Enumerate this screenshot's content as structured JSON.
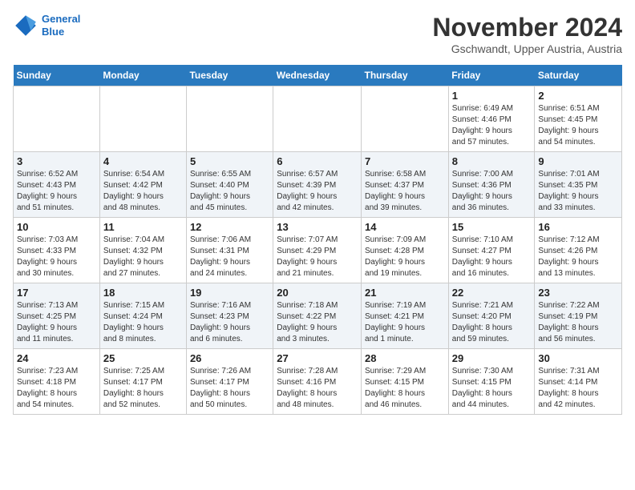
{
  "header": {
    "logo_line1": "General",
    "logo_line2": "Blue",
    "month": "November 2024",
    "location": "Gschwandt, Upper Austria, Austria"
  },
  "weekdays": [
    "Sunday",
    "Monday",
    "Tuesday",
    "Wednesday",
    "Thursday",
    "Friday",
    "Saturday"
  ],
  "weeks": [
    [
      {
        "day": "",
        "info": ""
      },
      {
        "day": "",
        "info": ""
      },
      {
        "day": "",
        "info": ""
      },
      {
        "day": "",
        "info": ""
      },
      {
        "day": "",
        "info": ""
      },
      {
        "day": "1",
        "info": "Sunrise: 6:49 AM\nSunset: 4:46 PM\nDaylight: 9 hours\nand 57 minutes."
      },
      {
        "day": "2",
        "info": "Sunrise: 6:51 AM\nSunset: 4:45 PM\nDaylight: 9 hours\nand 54 minutes."
      }
    ],
    [
      {
        "day": "3",
        "info": "Sunrise: 6:52 AM\nSunset: 4:43 PM\nDaylight: 9 hours\nand 51 minutes."
      },
      {
        "day": "4",
        "info": "Sunrise: 6:54 AM\nSunset: 4:42 PM\nDaylight: 9 hours\nand 48 minutes."
      },
      {
        "day": "5",
        "info": "Sunrise: 6:55 AM\nSunset: 4:40 PM\nDaylight: 9 hours\nand 45 minutes."
      },
      {
        "day": "6",
        "info": "Sunrise: 6:57 AM\nSunset: 4:39 PM\nDaylight: 9 hours\nand 42 minutes."
      },
      {
        "day": "7",
        "info": "Sunrise: 6:58 AM\nSunset: 4:37 PM\nDaylight: 9 hours\nand 39 minutes."
      },
      {
        "day": "8",
        "info": "Sunrise: 7:00 AM\nSunset: 4:36 PM\nDaylight: 9 hours\nand 36 minutes."
      },
      {
        "day": "9",
        "info": "Sunrise: 7:01 AM\nSunset: 4:35 PM\nDaylight: 9 hours\nand 33 minutes."
      }
    ],
    [
      {
        "day": "10",
        "info": "Sunrise: 7:03 AM\nSunset: 4:33 PM\nDaylight: 9 hours\nand 30 minutes."
      },
      {
        "day": "11",
        "info": "Sunrise: 7:04 AM\nSunset: 4:32 PM\nDaylight: 9 hours\nand 27 minutes."
      },
      {
        "day": "12",
        "info": "Sunrise: 7:06 AM\nSunset: 4:31 PM\nDaylight: 9 hours\nand 24 minutes."
      },
      {
        "day": "13",
        "info": "Sunrise: 7:07 AM\nSunset: 4:29 PM\nDaylight: 9 hours\nand 21 minutes."
      },
      {
        "day": "14",
        "info": "Sunrise: 7:09 AM\nSunset: 4:28 PM\nDaylight: 9 hours\nand 19 minutes."
      },
      {
        "day": "15",
        "info": "Sunrise: 7:10 AM\nSunset: 4:27 PM\nDaylight: 9 hours\nand 16 minutes."
      },
      {
        "day": "16",
        "info": "Sunrise: 7:12 AM\nSunset: 4:26 PM\nDaylight: 9 hours\nand 13 minutes."
      }
    ],
    [
      {
        "day": "17",
        "info": "Sunrise: 7:13 AM\nSunset: 4:25 PM\nDaylight: 9 hours\nand 11 minutes."
      },
      {
        "day": "18",
        "info": "Sunrise: 7:15 AM\nSunset: 4:24 PM\nDaylight: 9 hours\nand 8 minutes."
      },
      {
        "day": "19",
        "info": "Sunrise: 7:16 AM\nSunset: 4:23 PM\nDaylight: 9 hours\nand 6 minutes."
      },
      {
        "day": "20",
        "info": "Sunrise: 7:18 AM\nSunset: 4:22 PM\nDaylight: 9 hours\nand 3 minutes."
      },
      {
        "day": "21",
        "info": "Sunrise: 7:19 AM\nSunset: 4:21 PM\nDaylight: 9 hours\nand 1 minute."
      },
      {
        "day": "22",
        "info": "Sunrise: 7:21 AM\nSunset: 4:20 PM\nDaylight: 8 hours\nand 59 minutes."
      },
      {
        "day": "23",
        "info": "Sunrise: 7:22 AM\nSunset: 4:19 PM\nDaylight: 8 hours\nand 56 minutes."
      }
    ],
    [
      {
        "day": "24",
        "info": "Sunrise: 7:23 AM\nSunset: 4:18 PM\nDaylight: 8 hours\nand 54 minutes."
      },
      {
        "day": "25",
        "info": "Sunrise: 7:25 AM\nSunset: 4:17 PM\nDaylight: 8 hours\nand 52 minutes."
      },
      {
        "day": "26",
        "info": "Sunrise: 7:26 AM\nSunset: 4:17 PM\nDaylight: 8 hours\nand 50 minutes."
      },
      {
        "day": "27",
        "info": "Sunrise: 7:28 AM\nSunset: 4:16 PM\nDaylight: 8 hours\nand 48 minutes."
      },
      {
        "day": "28",
        "info": "Sunrise: 7:29 AM\nSunset: 4:15 PM\nDaylight: 8 hours\nand 46 minutes."
      },
      {
        "day": "29",
        "info": "Sunrise: 7:30 AM\nSunset: 4:15 PM\nDaylight: 8 hours\nand 44 minutes."
      },
      {
        "day": "30",
        "info": "Sunrise: 7:31 AM\nSunset: 4:14 PM\nDaylight: 8 hours\nand 42 minutes."
      }
    ]
  ]
}
